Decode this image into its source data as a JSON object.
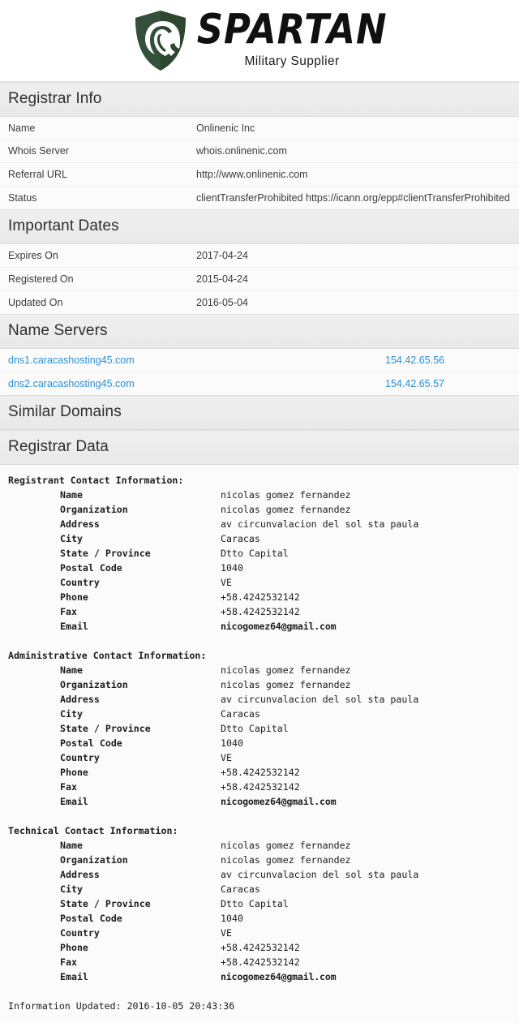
{
  "brand": {
    "name": "SPARTAN",
    "tagline": "Military Supplier",
    "shield_color": "#2d4630",
    "wordmark_color": "#101010"
  },
  "theme": {
    "section_header_bg": "#ebebeb",
    "row_bg": "#fbfbfb",
    "link_color": "#2d8fd5",
    "text_color": "#333333"
  },
  "sections": {
    "registrar_info": {
      "title": "Registrar Info",
      "rows": [
        {
          "label": "Name",
          "value": "Onlinenic Inc"
        },
        {
          "label": "Whois Server",
          "value": "whois.onlinenic.com"
        },
        {
          "label": "Referral URL",
          "value": "http://www.onlinenic.com"
        },
        {
          "label": "Status",
          "value": "clientTransferProhibited https://icann.org/epp#clientTransferProhibited"
        }
      ]
    },
    "important_dates": {
      "title": "Important Dates",
      "rows": [
        {
          "label": "Expires On",
          "value": "2017-04-24"
        },
        {
          "label": "Registered On",
          "value": "2015-04-24"
        },
        {
          "label": "Updated On",
          "value": "2016-05-04"
        }
      ]
    },
    "name_servers": {
      "title": "Name Servers",
      "rows": [
        {
          "host": "dns1.caracashosting45.com",
          "ip": "154.42.65.56"
        },
        {
          "host": "dns2.caracashosting45.com",
          "ip": "154.42.65.57"
        }
      ]
    },
    "similar_domains": {
      "title": "Similar Domains",
      "rows": []
    },
    "registrar_data": {
      "title": "Registrar Data",
      "blocks": [
        {
          "heading": "Registrant Contact Information:",
          "fields": [
            {
              "label": "Name",
              "value": "nicolas gomez fernandez",
              "mono_bold": false
            },
            {
              "label": "Organization",
              "value": "nicolas gomez fernandez",
              "mono_bold": false
            },
            {
              "label": "Address",
              "value": "av circunvalacion del sol sta paula",
              "mono_bold": false
            },
            {
              "label": "City",
              "value": "Caracas",
              "mono_bold": false
            },
            {
              "label": "State / Province",
              "value": "Dtto Capital",
              "mono_bold": false
            },
            {
              "label": "Postal Code",
              "value": "1040",
              "mono_bold": false
            },
            {
              "label": "Country",
              "value": "VE",
              "mono_bold": false
            },
            {
              "label": "Phone",
              "value": "+58.4242532142",
              "mono_bold": false
            },
            {
              "label": "Fax",
              "value": "+58.4242532142",
              "mono_bold": false
            },
            {
              "label": "Email",
              "value": "nicogomez64@gmail.com",
              "mono_bold": true
            }
          ]
        },
        {
          "heading": "Administrative Contact Information:",
          "fields": [
            {
              "label": "Name",
              "value": "nicolas gomez fernandez",
              "mono_bold": false
            },
            {
              "label": "Organization",
              "value": "nicolas gomez fernandez",
              "mono_bold": false
            },
            {
              "label": "Address",
              "value": "av circunvalacion del sol sta paula",
              "mono_bold": false
            },
            {
              "label": "City",
              "value": "Caracas",
              "mono_bold": false
            },
            {
              "label": "State / Province",
              "value": "Dtto Capital",
              "mono_bold": false
            },
            {
              "label": "Postal Code",
              "value": "1040",
              "mono_bold": false
            },
            {
              "label": "Country",
              "value": "VE",
              "mono_bold": false
            },
            {
              "label": "Phone",
              "value": "+58.4242532142",
              "mono_bold": false
            },
            {
              "label": "Fax",
              "value": "+58.4242532142",
              "mono_bold": false
            },
            {
              "label": "Email",
              "value": "nicogomez64@gmail.com",
              "mono_bold": true
            }
          ]
        },
        {
          "heading": "Technical Contact Information:",
          "fields": [
            {
              "label": "Name",
              "value": "nicolas gomez fernandez",
              "mono_bold": false
            },
            {
              "label": "Organization",
              "value": "nicolas gomez fernandez",
              "mono_bold": false
            },
            {
              "label": "Address",
              "value": "av circunvalacion del sol sta paula",
              "mono_bold": false
            },
            {
              "label": "City",
              "value": "Caracas",
              "mono_bold": false
            },
            {
              "label": "State / Province",
              "value": "Dtto Capital",
              "mono_bold": false
            },
            {
              "label": "Postal Code",
              "value": "1040",
              "mono_bold": false
            },
            {
              "label": "Country",
              "value": "VE",
              "mono_bold": false
            },
            {
              "label": "Phone",
              "value": "+58.4242532142",
              "mono_bold": false
            },
            {
              "label": "Fax",
              "value": "+58.4242532142",
              "mono_bold": false
            },
            {
              "label": "Email",
              "value": "nicogomez64@gmail.com",
              "mono_bold": true
            }
          ]
        }
      ],
      "footer": "Information Updated: 2016-10-05 20:43:36"
    }
  }
}
